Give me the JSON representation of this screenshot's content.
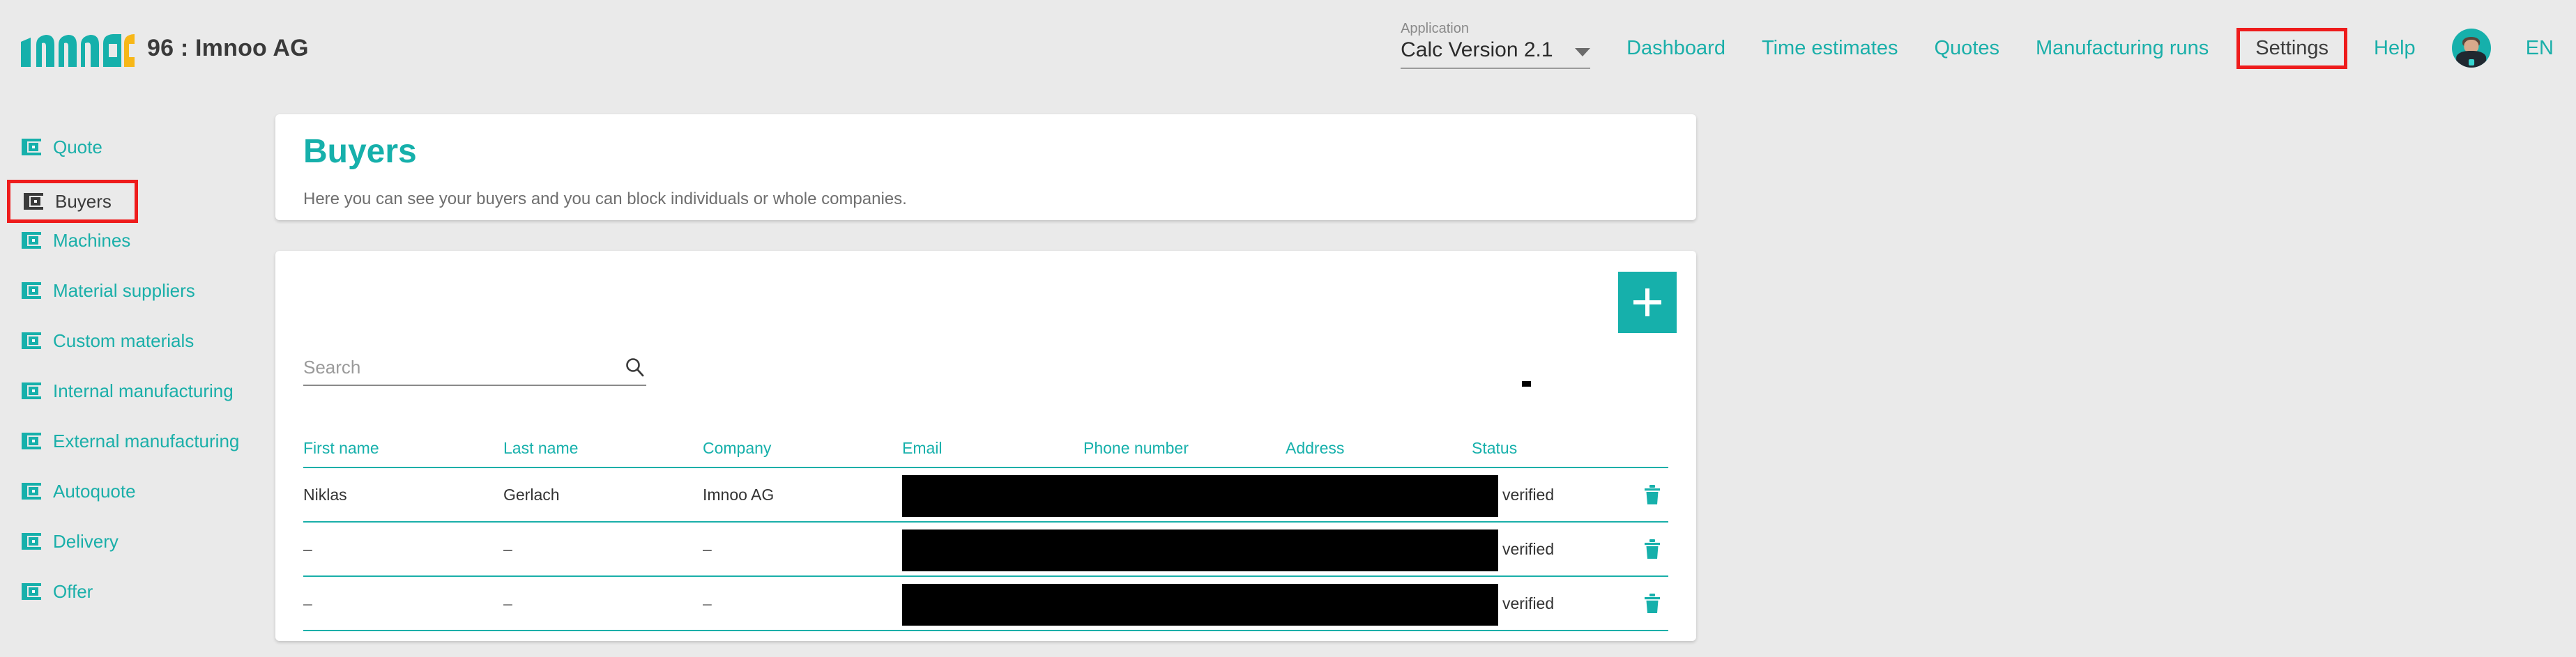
{
  "header": {
    "logo_text": "imnoo",
    "brand_text": "96 : Imnoo AG",
    "application": {
      "label": "Application",
      "value": "Calc Version 2.1",
      "caret_icon": "chevron-down-icon"
    },
    "nav": [
      {
        "label": "Dashboard",
        "active": false
      },
      {
        "label": "Time estimates",
        "active": false
      },
      {
        "label": "Quotes",
        "active": false
      },
      {
        "label": "Manufacturing runs",
        "active": false
      },
      {
        "label": "Settings",
        "active": true
      },
      {
        "label": "Help",
        "active": false
      }
    ],
    "language": "EN",
    "avatar_icon": "avatar"
  },
  "sidebar": {
    "items": [
      {
        "label": "Quote",
        "active": false
      },
      {
        "label": "Buyers",
        "active": true
      },
      {
        "label": "Machines",
        "active": false
      },
      {
        "label": "Material suppliers",
        "active": false
      },
      {
        "label": "Custom materials",
        "active": false
      },
      {
        "label": "Internal manufacturing",
        "active": false
      },
      {
        "label": "External manufacturing",
        "active": false
      },
      {
        "label": "Autoquote",
        "active": false
      },
      {
        "label": "Delivery",
        "active": false
      },
      {
        "label": "Offer",
        "active": false
      }
    ]
  },
  "page": {
    "title": "Buyers",
    "subtitle": "Here you can see your buyers and you can block individuals or whole companies."
  },
  "toolbar": {
    "add_label": "+",
    "search_placeholder": "Search",
    "search_value": "",
    "search_icon": "search-icon"
  },
  "table": {
    "columns": [
      "First name",
      "Last name",
      "Company",
      "Email",
      "Phone number",
      "Address",
      "Status"
    ],
    "rows": [
      {
        "first_name": "Niklas",
        "last_name": "Gerlach",
        "company": "Imnoo AG",
        "email": "",
        "phone": "",
        "address": "",
        "status": "verified"
      },
      {
        "first_name": "–",
        "last_name": "–",
        "company": "–",
        "email": "",
        "phone": "",
        "address": "",
        "status": "verified"
      },
      {
        "first_name": "–",
        "last_name": "–",
        "company": "–",
        "email": "",
        "phone": "",
        "address": "",
        "status": "verified"
      }
    ]
  },
  "colors": {
    "accent_teal": "#16b0ab",
    "accent_yellow": "#f7b718",
    "highlight_red": "#ee1c1c",
    "background_gray": "#eaeaea",
    "card_white": "#ffffff"
  }
}
